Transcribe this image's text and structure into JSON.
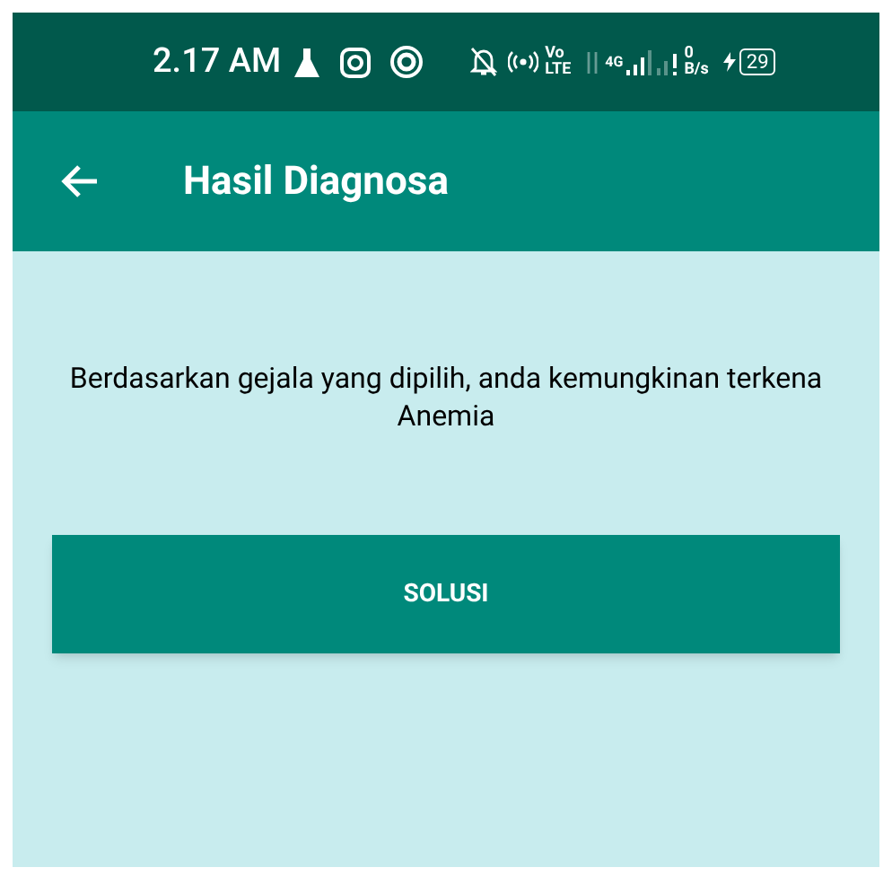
{
  "status_bar": {
    "time": "2.17 AM",
    "volte_top": "Vo",
    "volte_bottom": "LTE",
    "network": "4G",
    "speed_value": "0",
    "speed_unit": "B/s",
    "battery": "29"
  },
  "app_bar": {
    "title": "Hasil Diagnosa"
  },
  "result": {
    "message": "Berdasarkan gejala yang dipilih, anda kemungkinan terkena Anemia"
  },
  "buttons": [
    {
      "label": "SOLUSI"
    }
  ]
}
